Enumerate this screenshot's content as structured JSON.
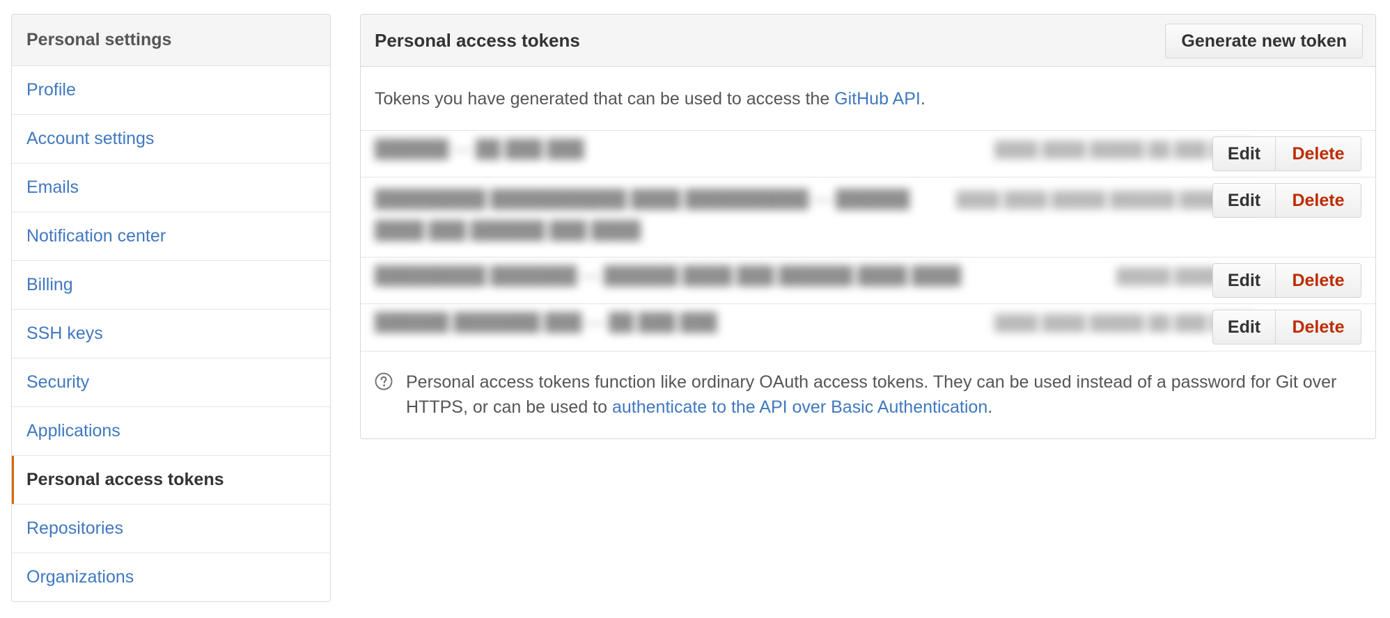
{
  "sidebar": {
    "header": "Personal settings",
    "items": [
      {
        "label": "Profile"
      },
      {
        "label": "Account settings"
      },
      {
        "label": "Emails"
      },
      {
        "label": "Notification center"
      },
      {
        "label": "Billing"
      },
      {
        "label": "SSH keys"
      },
      {
        "label": "Security"
      },
      {
        "label": "Applications"
      },
      {
        "label": "Personal access tokens",
        "selected": true
      },
      {
        "label": "Repositories"
      },
      {
        "label": "Organizations"
      }
    ]
  },
  "main": {
    "title": "Personal access tokens",
    "generate_button": "Generate new token",
    "intro": {
      "prefix": "Tokens you have generated that can be used to access the ",
      "link": "GitHub API",
      "suffix": "."
    },
    "tokens": [
      {
        "edit_label": "Edit",
        "delete_label": "Delete"
      },
      {
        "edit_label": "Edit",
        "delete_label": "Delete"
      },
      {
        "edit_label": "Edit",
        "delete_label": "Delete"
      },
      {
        "edit_label": "Edit",
        "delete_label": "Delete"
      }
    ],
    "help": {
      "prefix": "Personal access tokens function like ordinary OAuth access tokens. They can be used instead of a password for Git over HTTPS, or can be used to ",
      "link": "authenticate to the API over Basic Authentication",
      "suffix": "."
    }
  },
  "colors": {
    "link": "#4078c0",
    "selected_indicator": "#d26911",
    "delete": "#bd2c00"
  },
  "icons": {
    "help": "question-circle-icon"
  }
}
